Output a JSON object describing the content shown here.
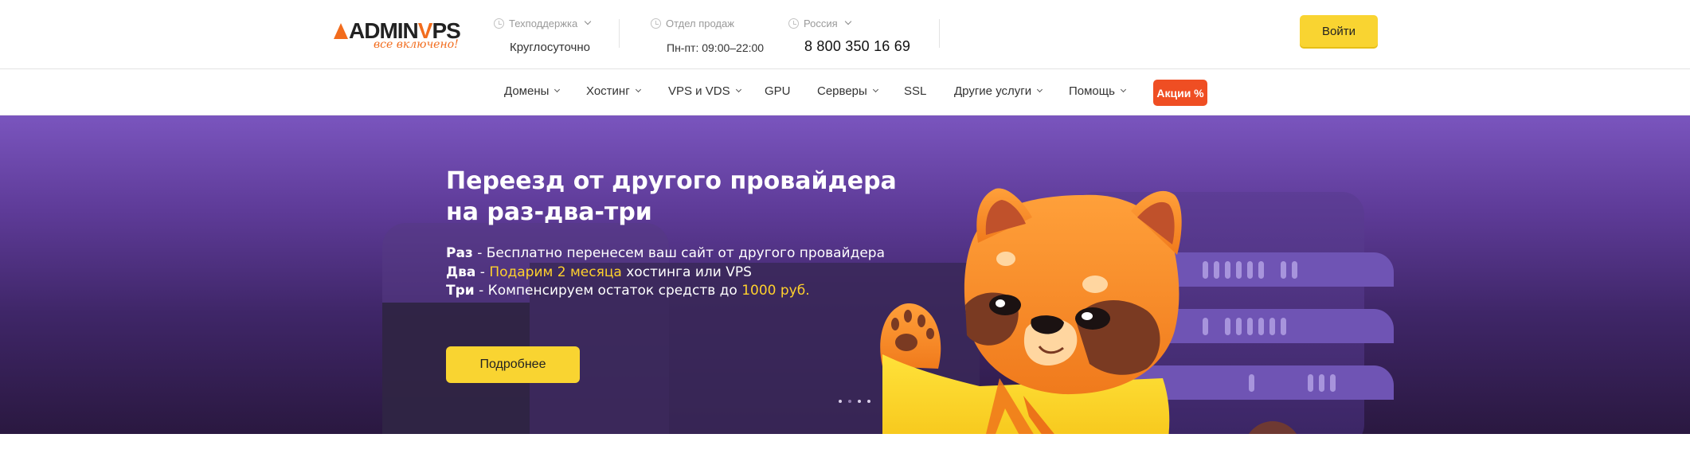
{
  "header": {
    "logo": {
      "text_main_left": "ADMIN",
      "text_main_right": "PS",
      "text_main_v": "V",
      "slogan": "все включено!"
    },
    "support": {
      "label": "Техподдержка",
      "value": "Круглосуточно"
    },
    "sales": {
      "label": "Отдел продаж",
      "value": "Пн-пт: 09:00–22:00"
    },
    "region": {
      "label": "Россия",
      "phone": "8 800 350 16 69"
    },
    "login_label": "Войти"
  },
  "nav": {
    "items": [
      {
        "label": "Домены",
        "dropdown": true
      },
      {
        "label": "Хостинг",
        "dropdown": true
      },
      {
        "label": "VPS и VDS",
        "dropdown": true
      },
      {
        "label": "GPU",
        "dropdown": false
      },
      {
        "label": "Серверы",
        "dropdown": true
      },
      {
        "label": "SSL",
        "dropdown": false
      },
      {
        "label": "Другие услуги",
        "dropdown": true
      },
      {
        "label": "Помощь",
        "dropdown": true
      }
    ],
    "promo_label": "Акции %"
  },
  "hero": {
    "title_line1": "Переезд от другого провайдера",
    "title_line2": "на раз-два-три",
    "line1": {
      "key": "Раз",
      "sep": " - ",
      "text": "Бесплатно перенесем ваш сайт от другого провайдера"
    },
    "line2": {
      "key": "Два",
      "sep": " - ",
      "highlight": "Подарим 2 месяца",
      "text": " хостинга или VPS"
    },
    "line3": {
      "key": "Три",
      "sep": " - ",
      "text": "Компенсируем остаток средств до ",
      "highlight": "1000 руб."
    },
    "button_label": "Подробнее",
    "slides_total": 4,
    "slide_active": 1
  },
  "colors": {
    "accent_yellow": "#f9d431",
    "promo_red": "#ef4e23",
    "brand_orange": "#f26c1d",
    "hero_purple": "#5e3b98",
    "highlight_yellow": "#ffd12c"
  },
  "icons": [
    "clock-icon",
    "chevron-down-icon",
    "fox-mascot-illustration",
    "server-rack-illustration"
  ]
}
